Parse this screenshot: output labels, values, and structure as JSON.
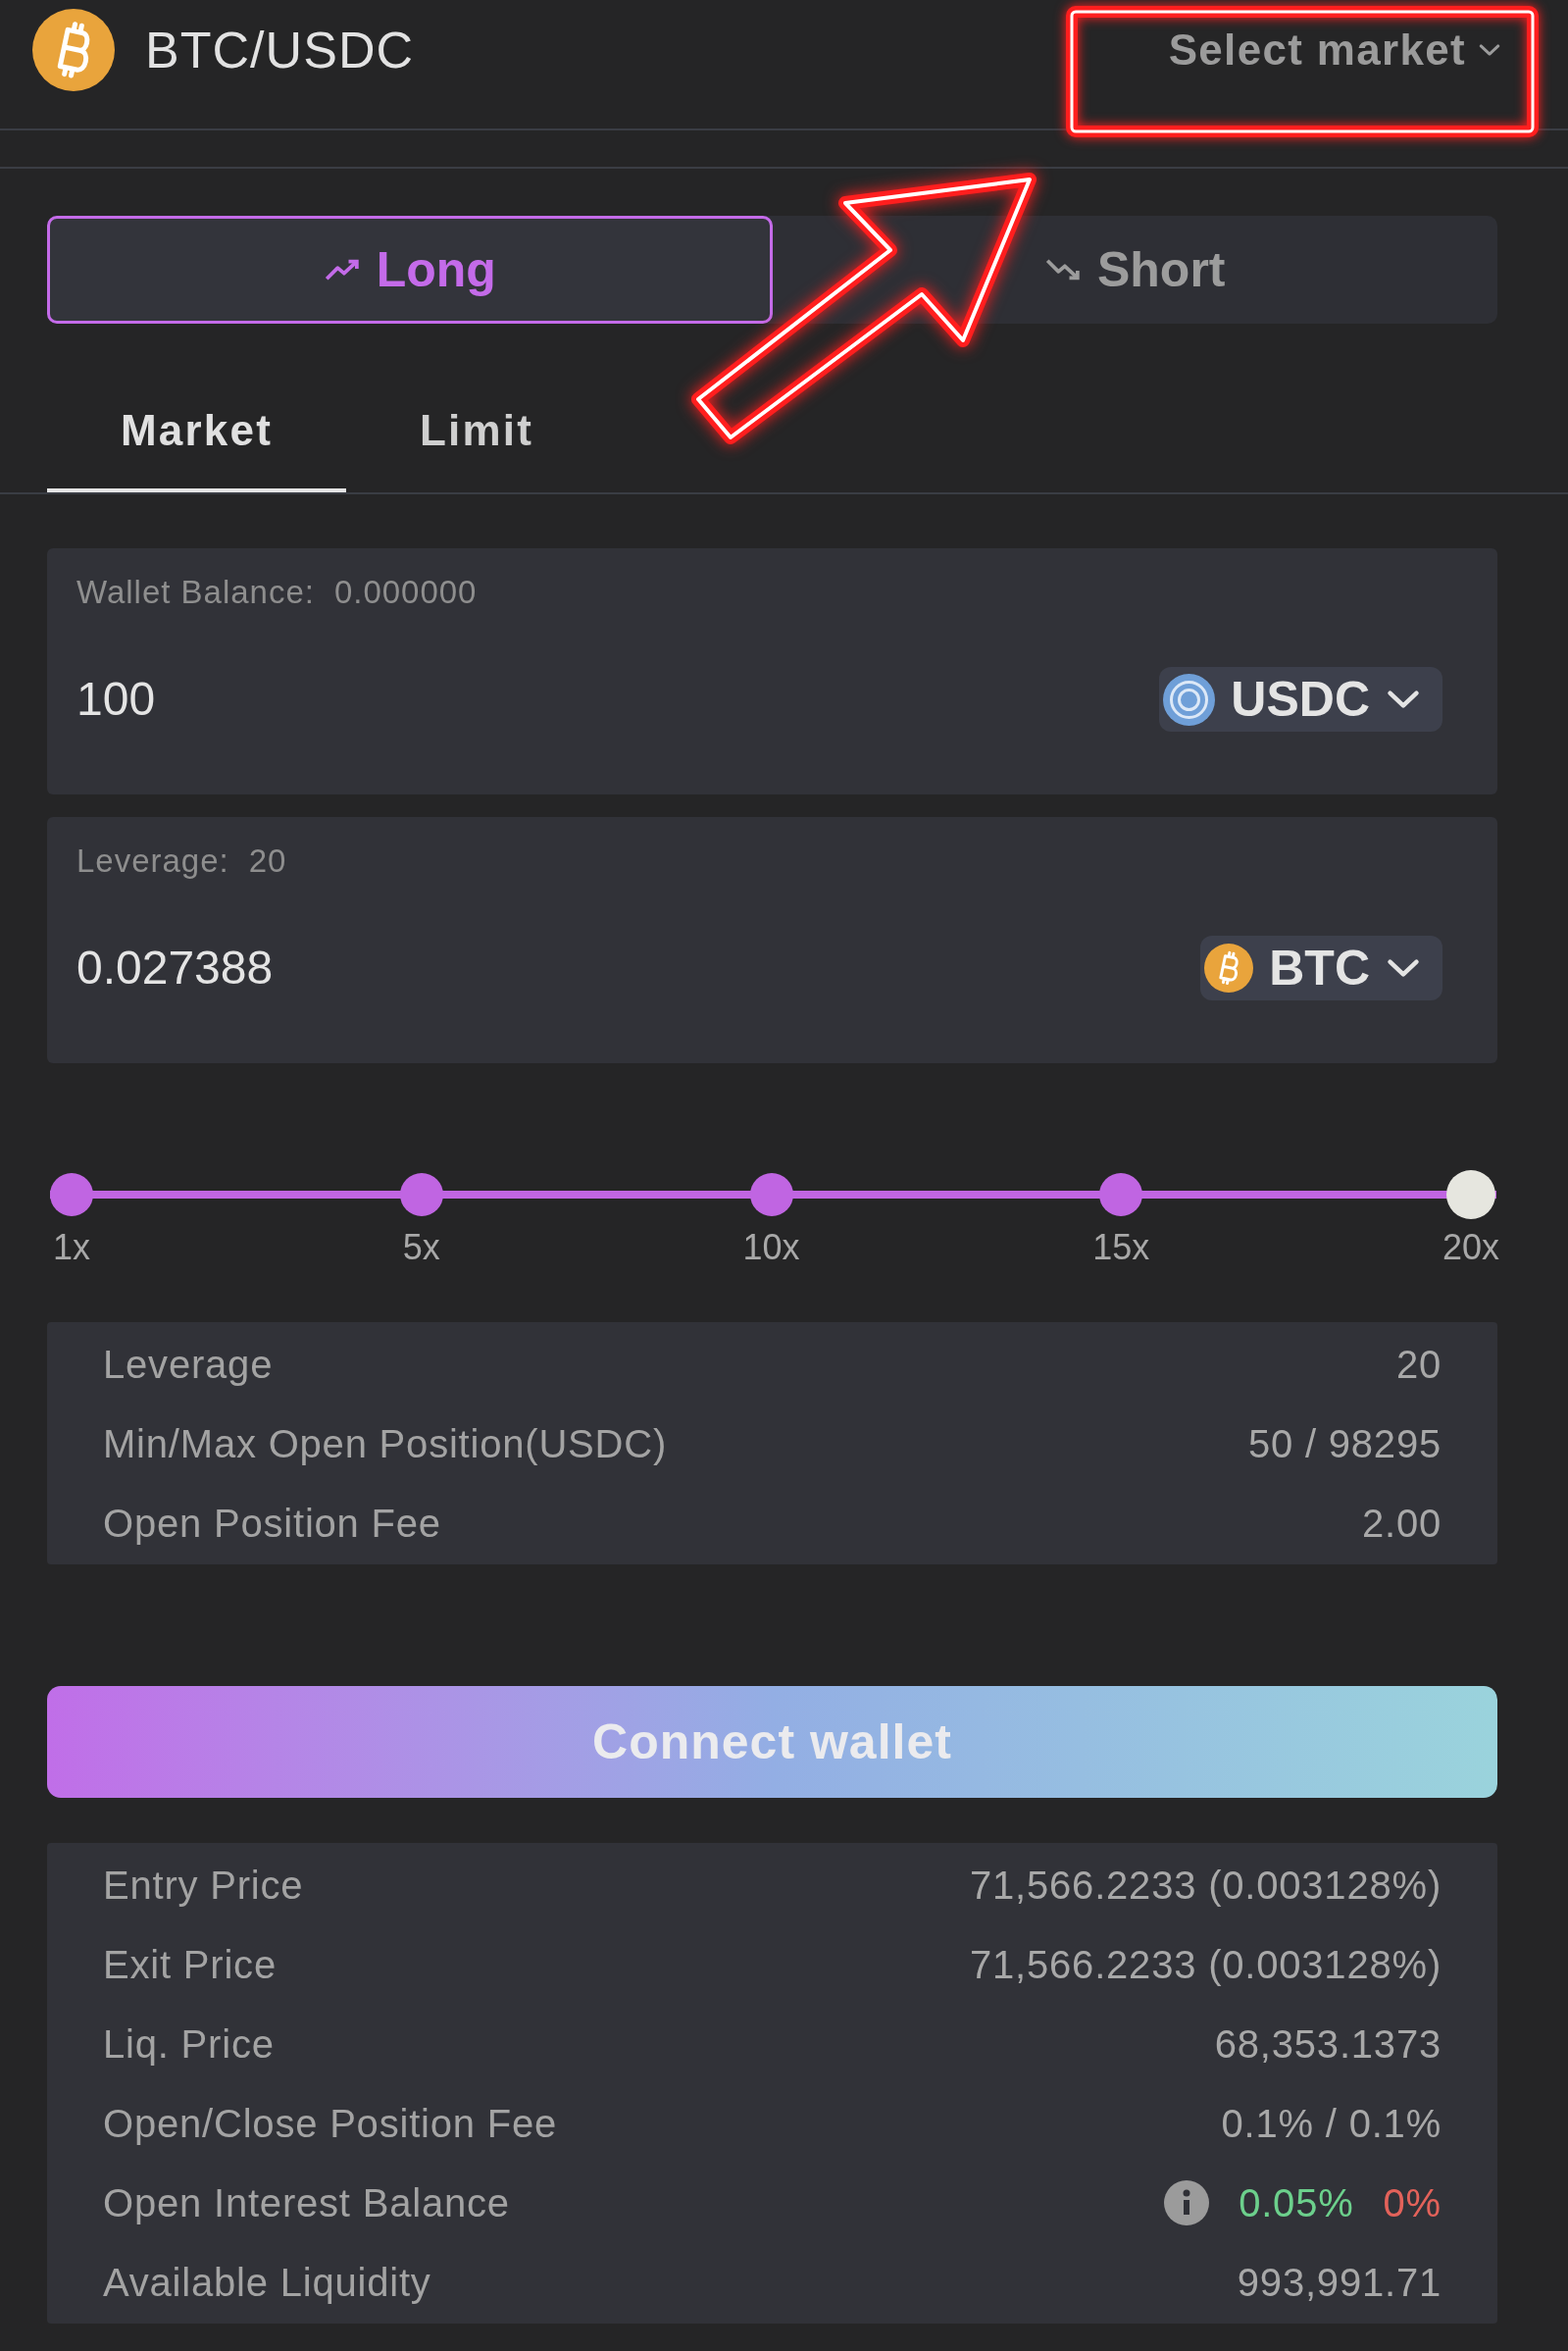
{
  "header": {
    "pair": "BTC/USDC",
    "market_select": "Select market"
  },
  "sides": [
    {
      "kind": "long",
      "label": "Long",
      "selected": true
    },
    {
      "kind": "short",
      "label": "Short",
      "selected": false
    }
  ],
  "order_tabs": [
    {
      "label": "Market",
      "selected": true
    },
    {
      "label": "Limit",
      "selected": false
    }
  ],
  "inputs": [
    {
      "kind": "usdc",
      "caption": "Wallet Balance:",
      "caption_value": "0.000000",
      "value": "100",
      "token": "USDC"
    },
    {
      "kind": "btc",
      "caption": "Leverage:",
      "caption_value": "20",
      "value": "0.027388",
      "token": "BTC"
    }
  ],
  "leverage_slider": {
    "level": 1,
    "marks": [
      "1x",
      "5x",
      "10x",
      "15x",
      "20x"
    ]
  },
  "summary": [
    {
      "label": "Leverage",
      "value": "20"
    },
    {
      "label": "Min/Max Open Position(USDC)",
      "value": "50 / 98295"
    },
    {
      "label": "Open Position Fee",
      "value": "2.00"
    }
  ],
  "connect_button": "Connect wallet",
  "details": [
    {
      "kind": "text",
      "label": "Entry Price",
      "value": "71,566.2233 (0.003128%)"
    },
    {
      "kind": "text",
      "label": "Exit Price",
      "value": "71,566.2233 (0.003128%)"
    },
    {
      "kind": "text",
      "label": "Liq. Price",
      "value": "68,353.1373"
    },
    {
      "kind": "text",
      "label": "Open/Close Position Fee",
      "value": "0.1% / 0.1%"
    },
    {
      "kind": "balance",
      "label": "Open Interest Balance",
      "long": "0.05%",
      "short": "0%"
    },
    {
      "kind": "text",
      "label": "Available Liquidity",
      "value": "993,991.71"
    }
  ]
}
